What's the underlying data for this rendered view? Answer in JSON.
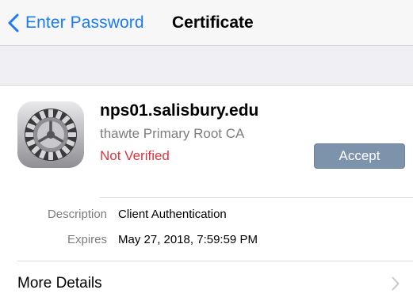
{
  "navbar": {
    "back_label": "Enter Password",
    "title": "Certificate",
    "accent_color": "#1a7cf5"
  },
  "certificate": {
    "icon": "settings-gear-icon",
    "name": "nps01.salisbury.edu",
    "issuer": "thawte Primary Root CA",
    "status": "Not Verified",
    "status_color": "#d9363e",
    "accept_label": "Accept",
    "accept_color": "#7d92ab"
  },
  "details": [
    {
      "label": "Description",
      "value": "Client Authentication"
    },
    {
      "label": "Expires",
      "value": "May 27, 2018, 7:59:59 PM"
    }
  ],
  "more_details": {
    "label": "More Details",
    "icon": "chevron-right-icon"
  }
}
